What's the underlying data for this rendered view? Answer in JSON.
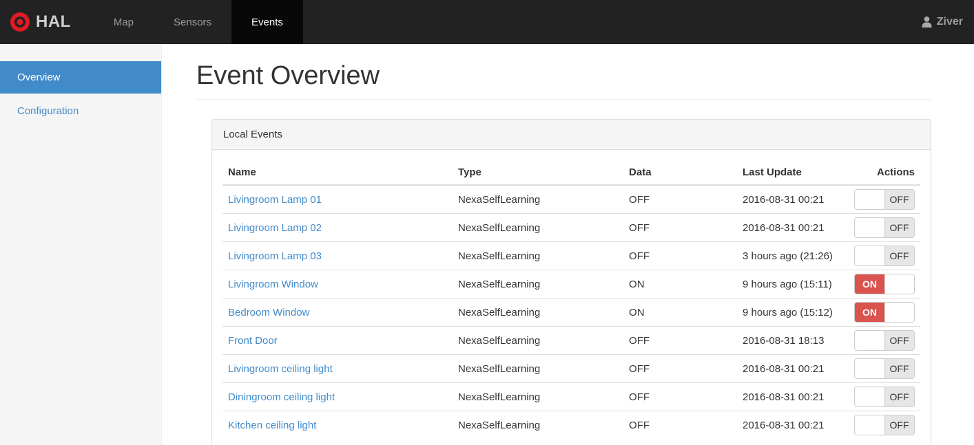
{
  "navbar": {
    "brand": "HAL",
    "items": [
      {
        "label": "Map",
        "active": false
      },
      {
        "label": "Sensors",
        "active": false
      },
      {
        "label": "Events",
        "active": true
      }
    ],
    "user": "Ziver"
  },
  "sidebar": {
    "items": [
      {
        "label": "Overview",
        "active": true
      },
      {
        "label": "Configuration",
        "active": false
      }
    ]
  },
  "page": {
    "title": "Event Overview"
  },
  "panel": {
    "title": "Local Events",
    "table": {
      "headers": [
        "Name",
        "Type",
        "Data",
        "Last Update",
        "Actions"
      ],
      "rows": [
        {
          "name": "Livingroom Lamp 01",
          "type": "NexaSelfLearning",
          "data": "OFF",
          "last_update": "2016-08-31 00:21",
          "switch": "OFF"
        },
        {
          "name": "Livingroom Lamp 02",
          "type": "NexaSelfLearning",
          "data": "OFF",
          "last_update": "2016-08-31 00:21",
          "switch": "OFF"
        },
        {
          "name": "Livingroom Lamp 03",
          "type": "NexaSelfLearning",
          "data": "OFF",
          "last_update": "3 hours ago (21:26)",
          "switch": "OFF"
        },
        {
          "name": "Livingroom Window",
          "type": "NexaSelfLearning",
          "data": "ON",
          "last_update": "9 hours ago (15:11)",
          "switch": "ON"
        },
        {
          "name": "Bedroom Window",
          "type": "NexaSelfLearning",
          "data": "ON",
          "last_update": "9 hours ago (15:12)",
          "switch": "ON"
        },
        {
          "name": "Front Door",
          "type": "NexaSelfLearning",
          "data": "OFF",
          "last_update": "2016-08-31 18:13",
          "switch": "OFF"
        },
        {
          "name": "Livingroom ceiling light",
          "type": "NexaSelfLearning",
          "data": "OFF",
          "last_update": "2016-08-31 00:21",
          "switch": "OFF"
        },
        {
          "name": "Diningroom ceiling light",
          "type": "NexaSelfLearning",
          "data": "OFF",
          "last_update": "2016-08-31 00:21",
          "switch": "OFF"
        },
        {
          "name": "Kitchen ceiling light",
          "type": "NexaSelfLearning",
          "data": "OFF",
          "last_update": "2016-08-31 00:21",
          "switch": "OFF"
        }
      ]
    }
  },
  "colors": {
    "navbar_bg": "#222222",
    "navbar_active_bg": "#080808",
    "accent_blue": "#428bca",
    "switch_on_red": "#d9534f",
    "switch_off_gray": "#e6e6e6",
    "logo_red": "#e01b24"
  }
}
